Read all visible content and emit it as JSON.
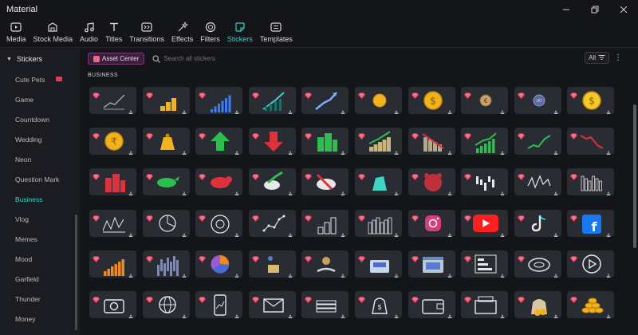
{
  "window": {
    "title": "Material",
    "controls": [
      "minimize",
      "restore",
      "close"
    ]
  },
  "toolbar": [
    {
      "label": "Media",
      "icon": "media-icon"
    },
    {
      "label": "Stock Media",
      "icon": "stock-media-icon"
    },
    {
      "label": "Audio",
      "icon": "audio-icon"
    },
    {
      "label": "Titles",
      "icon": "titles-icon"
    },
    {
      "label": "Transitions",
      "icon": "transitions-icon"
    },
    {
      "label": "Effects",
      "icon": "effects-icon"
    },
    {
      "label": "Filters",
      "icon": "filters-icon"
    },
    {
      "label": "Stickers",
      "icon": "stickers-icon",
      "active": true
    },
    {
      "label": "Templates",
      "icon": "templates-icon"
    }
  ],
  "sidebar": {
    "header": "Stickers",
    "items": [
      {
        "label": "Cute Pets",
        "badge": true
      },
      {
        "label": "Game"
      },
      {
        "label": "Countdown"
      },
      {
        "label": "Wedding"
      },
      {
        "label": "Neon"
      },
      {
        "label": "Question Mark"
      },
      {
        "label": "Business",
        "active": true
      },
      {
        "label": "Vlog"
      },
      {
        "label": "Memes"
      },
      {
        "label": "Mood"
      },
      {
        "label": "Garfield"
      },
      {
        "label": "Thunder"
      },
      {
        "label": "Money"
      }
    ]
  },
  "main": {
    "asset_center": "Asset Center",
    "search_placeholder": "Search all stickers",
    "filter_value": "All",
    "section_title": "BUSINESS"
  },
  "colors": {
    "accent": "#2fd5c8",
    "premium": "#e23b57",
    "card_bg": "#2a2c33"
  },
  "stickers": [
    "line-chart-arrow",
    "gold-coins-chart",
    "blue-bar-chart",
    "teal-growth-chart",
    "blue-arrow-chart",
    "gold-coin",
    "dollar-coin",
    "euro-coin",
    "gold-coin-small",
    "dollar-coin-alt",
    "rupee-coin",
    "money-bag",
    "green-up-arrow",
    "red-down-arrow",
    "green-buildings",
    "coin-stacks-chart",
    "coin-stacks-down",
    "green-bar-chart",
    "green-trend-line",
    "red-trend-line",
    "red-buildings",
    "green-bull",
    "red-bear",
    "bull-arrow",
    "bear-arrow",
    "teal-bull",
    "red-bear-head",
    "candlestick-chart",
    "white-line-chart",
    "bar-chart-outline",
    "sketch-chart",
    "pie-sketch",
    "dashboard-sketch",
    "dot-line-chart",
    "3d-bars",
    "city-bars",
    "instagram-logo",
    "youtube-logo",
    "tiktok-logo",
    "facebook-logo",
    "orange-bars",
    "blue-bars",
    "pie-chart-3d",
    "money-delivery",
    "coin-hand",
    "cash-register",
    "browser-window",
    "bar-chart-board",
    "stadium",
    "play-button",
    "camera",
    "globe",
    "phone-chart",
    "envelope-cursor",
    "money-stack",
    "coin-bag",
    "wallet",
    "cash-box",
    "money-bag-gold",
    "coins-pile"
  ]
}
